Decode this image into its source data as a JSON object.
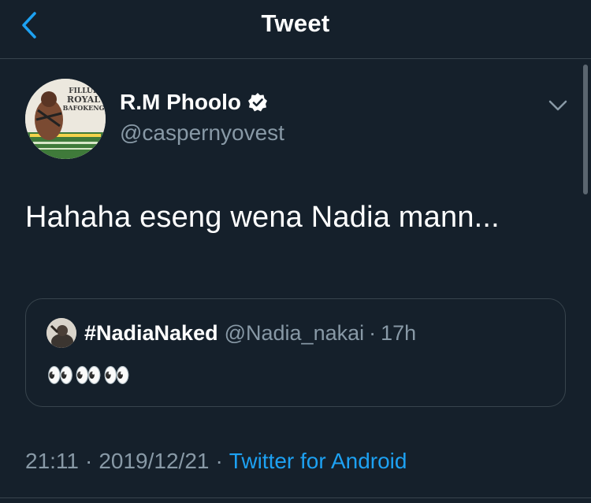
{
  "header": {
    "title": "Tweet",
    "back_icon": "chevron-left-icon"
  },
  "colors": {
    "background": "#15202b",
    "accent": "#1da1f2",
    "secondary_text": "#8899a6",
    "border": "#38444d"
  },
  "tweet": {
    "author": {
      "name": "R.M Phoolo",
      "handle": "@caspernyovest",
      "verified": true,
      "avatar_text": [
        "FILLUP",
        "ROYAL",
        "BAFOKENG"
      ]
    },
    "text": "Hahaha eseng wena Nadia mann...",
    "quoted": {
      "name": "#NadiaNaked",
      "handle": "@Nadia_nakai",
      "separator": "·",
      "time": "17h",
      "text": "👀👀👀"
    },
    "time": "21:11",
    "date": "2019/12/21",
    "separator": "·",
    "source": "Twitter for Android"
  }
}
